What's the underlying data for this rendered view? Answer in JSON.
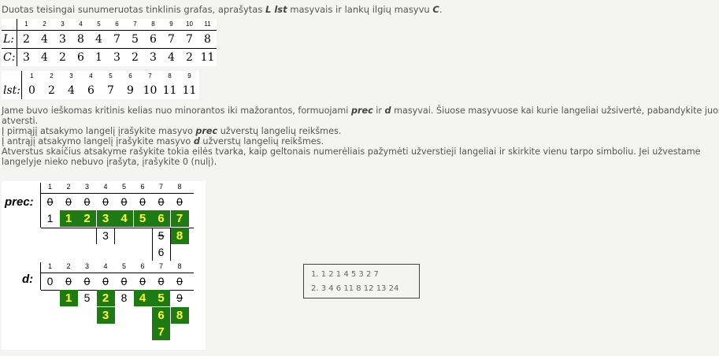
{
  "intro": {
    "text1": "Duotas teisingai sunumeruotas tinklinis grafas, aprašytas ",
    "arrays": "L lst",
    "text2": " masyvais ir lankų ilgių masyvu ",
    "c": "C",
    "text3": "."
  },
  "lc_table": {
    "indices": [
      "1",
      "2",
      "3",
      "4",
      "5",
      "6",
      "7",
      "8",
      "9",
      "10",
      "11"
    ],
    "L_label": "L:",
    "L": [
      "2",
      "4",
      "3",
      "8",
      "4",
      "7",
      "5",
      "6",
      "7",
      "7",
      "8"
    ],
    "C_label": "C:",
    "C": [
      "3",
      "4",
      "2",
      "6",
      "1",
      "3",
      "2",
      "3",
      "4",
      "2",
      "11"
    ]
  },
  "lst_table": {
    "indices": [
      "1",
      "2",
      "3",
      "4",
      "5",
      "6",
      "7",
      "8",
      "9"
    ],
    "label": "lst:",
    "values": [
      "0",
      "2",
      "4",
      "6",
      "7",
      "9",
      "10",
      "11",
      "11"
    ]
  },
  "instructions": {
    "l1a": "Jame buvo ieškomas kritinis kelias nuo minorantos iki mažorantos, formuojami ",
    "prec": "prec",
    "l1b": " ir ",
    "d": "d",
    "l1c": " masyvai. Šiuose masyvuose kai kurie langeliai užsivertė, pabandykite juos",
    "l2": "atversti.",
    "l3a": "Į pirmąjį atsakymo langelį įrašykite masyvo ",
    "l3b": " užverstų langelių reikšmes.",
    "l4a": "Į antrąjį atsakymo langelį įrašykite masyvo ",
    "l4b": " užverstų langelių reikšmes.",
    "l5": "Atverstus skaičius atsakyme rašykite tokia eilės tvarka, kaip geltonais numerėliais pažymėti užverstieji langeliai ir skirkite vienu tarpo simboliu. Jei užvestame",
    "l6": "langelyje nieko nebuvo įrašyta, įrašykite 0 (nulį)."
  },
  "panel": {
    "prec_label": "prec:",
    "d_label": "d:",
    "indices": [
      "1",
      "2",
      "3",
      "4",
      "5",
      "6",
      "7",
      "8"
    ],
    "prec_row1": [
      "0",
      "0",
      "0",
      "0",
      "0",
      "0",
      "0",
      "0"
    ],
    "prec_row2": [
      "1",
      "1",
      "2",
      "3",
      "4",
      "5",
      "6",
      "7"
    ],
    "prec_row3_c4": "3",
    "prec_row3_c7": "5",
    "prec_row3_c8": "8",
    "prec_row4_c7": "6",
    "d_row1": [
      "0",
      "0",
      "0",
      "0",
      "0",
      "0",
      "0",
      "0"
    ],
    "d_row2": [
      "1",
      "5",
      "2",
      "8",
      "4",
      "5",
      "9"
    ],
    "d_row3": [
      "3",
      "6",
      "8"
    ],
    "d_row4": "7"
  },
  "answers": {
    "a1": "1.  1 2 1 4 5 3 2 7",
    "a2": "2.  3 4 6 11 8 12 13 24"
  }
}
